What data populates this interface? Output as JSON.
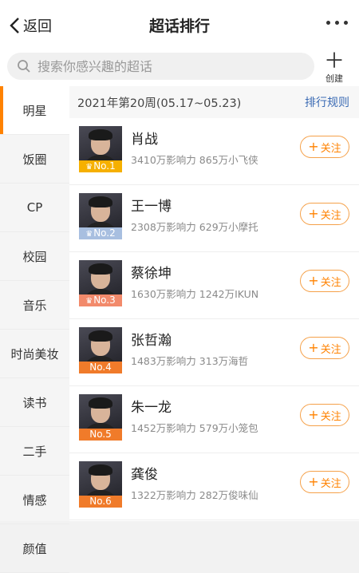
{
  "header": {
    "back_label": "返回",
    "title": "超话排行"
  },
  "search": {
    "placeholder": "搜索你感兴趣的超话",
    "create_label": "创建"
  },
  "sidebar": {
    "items": [
      "明星",
      "饭圈",
      "CP",
      "校园",
      "音乐",
      "时尚美妆",
      "读书",
      "二手",
      "情感",
      "颜值"
    ],
    "active": "明星"
  },
  "week": {
    "label": "2021年第20周(05.17~05.23)",
    "rules_label": "排行规则"
  },
  "follow_label": "关注",
  "colors": {
    "accent": "#ff8200",
    "rank1": "#f6b000",
    "rank2": "#a8bfe0",
    "rank3": "#f28a6b",
    "rank_default": "#f07b2a"
  },
  "ranking": [
    {
      "rank": "No.1",
      "name": "肖战",
      "influence": "3410万影响力",
      "fans": "865万小飞侠",
      "badge_color": "#f6b000",
      "crown": true
    },
    {
      "rank": "No.2",
      "name": "王一博",
      "influence": "2308万影响力",
      "fans": "629万小摩托",
      "badge_color": "#a8bfe0",
      "crown": true
    },
    {
      "rank": "No.3",
      "name": "蔡徐坤",
      "influence": "1630万影响力",
      "fans": "1242万IKUN",
      "badge_color": "#f28a6b",
      "crown": true
    },
    {
      "rank": "No.4",
      "name": "张哲瀚",
      "influence": "1483万影响力",
      "fans": "313万海哲",
      "badge_color": "#f07b2a",
      "crown": false
    },
    {
      "rank": "No.5",
      "name": "朱一龙",
      "influence": "1452万影响力",
      "fans": "579万小笼包",
      "badge_color": "#f07b2a",
      "crown": false
    },
    {
      "rank": "No.6",
      "name": "龚俊",
      "influence": "1322万影响力",
      "fans": "282万俊味仙",
      "badge_color": "#f07b2a",
      "crown": false
    }
  ]
}
